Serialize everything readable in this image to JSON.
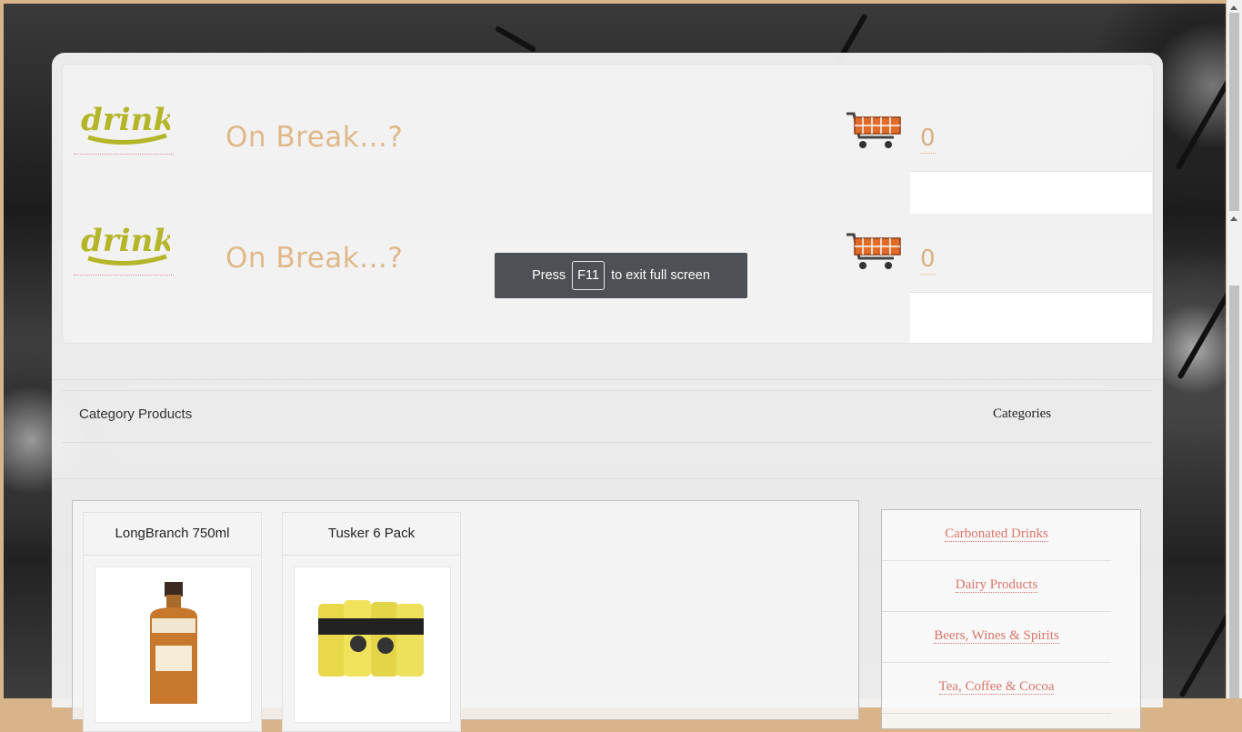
{
  "header": [
    {
      "tagline": "On Break...?",
      "cart_count": "0"
    },
    {
      "tagline": "On Break...?",
      "cart_count": "0"
    }
  ],
  "brand": {
    "logo_text": "drinks",
    "logo_color": "#b5b52a"
  },
  "toast": {
    "prefix": "Press",
    "key": "F11",
    "suffix": "to exit full screen"
  },
  "section": {
    "title": "Category Products",
    "sidebar_title": "Categories"
  },
  "products": [
    {
      "name": "LongBranch 750ml",
      "image": "whiskey-bottle-image"
    },
    {
      "name": "Tusker 6 Pack",
      "image": "beer-cans-image"
    }
  ],
  "categories": [
    {
      "label": "Carbonated Drinks"
    },
    {
      "label": "Dairy Products"
    },
    {
      "label": "Beers, Wines & Spirits"
    },
    {
      "label": "Tea, Coffee & Cocoa"
    }
  ],
  "colors": {
    "accent": "#e0b88a",
    "link": "#d9756a",
    "frame": "#d9b48a"
  }
}
